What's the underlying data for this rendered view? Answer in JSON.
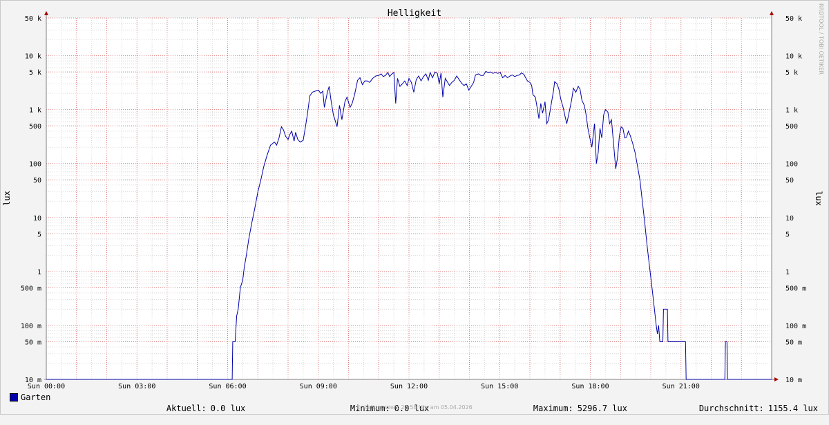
{
  "watermark": "RRDTOOL / TOBI OETIKER",
  "footer_text": "Erstellungszeit: 23:58 Uhr am 05.04.2026",
  "colors": {
    "series": "#0000aa",
    "background": "#f3f3f3",
    "plot_area": "#ffffff",
    "major_grid": "#e08080",
    "minor_grid": "#d8d8d8",
    "axis": "#808080",
    "arrow": "#aa0000"
  },
  "legend": {
    "series_name": "Garten",
    "aktuell_label": "Aktuell:",
    "aktuell_value": "0.0 lux",
    "minimum_label": "Minimum:",
    "minimum_value": "0.0 lux",
    "maximum_label": "Maximum:",
    "maximum_value": "5296.7 lux",
    "durchschnitt_label": "Durchschnitt:",
    "durchschnitt_value": "1155.4 lux"
  },
  "chart_data": {
    "type": "line",
    "title": "Helligkeit",
    "ylabel": "lux",
    "ylabel_right": "lux",
    "yscale": "log",
    "ylim": [
      10,
      50000
    ],
    "yunit_min": 0.01,
    "xlim": [
      0,
      24
    ],
    "grid": true,
    "xticks": [
      {
        "value": 0,
        "label": "Sun 00:00"
      },
      {
        "value": 3,
        "label": "Sun 03:00"
      },
      {
        "value": 6,
        "label": "Sun 06:00"
      },
      {
        "value": 9,
        "label": "Sun 09:00"
      },
      {
        "value": 12,
        "label": "Sun 12:00"
      },
      {
        "value": 15,
        "label": "Sun 15:00"
      },
      {
        "value": 18,
        "label": "Sun 18:00"
      },
      {
        "value": 21,
        "label": "Sun 21:00"
      }
    ],
    "yticks": [
      {
        "value": 50000,
        "label": "50 k"
      },
      {
        "value": 10000,
        "label": "10 k"
      },
      {
        "value": 5000,
        "label": "5 k"
      },
      {
        "value": 1000,
        "label": "1 k"
      },
      {
        "value": 500,
        "label": "500"
      },
      {
        "value": 100,
        "label": "100"
      },
      {
        "value": 50,
        "label": "50"
      },
      {
        "value": 10,
        "label": "10"
      },
      {
        "value": 5,
        "label": "5"
      },
      {
        "value": 1,
        "label": "1"
      },
      {
        "value": 0.5,
        "label": "500 m"
      },
      {
        "value": 0.1,
        "label": "100 m"
      },
      {
        "value": 0.05,
        "label": "50 m"
      },
      {
        "value": 0.01,
        "label": "10 m"
      }
    ],
    "series": [
      {
        "name": "Garten",
        "points": [
          [
            0.0,
            0.01
          ],
          [
            6.15,
            0.01
          ],
          [
            6.17,
            0.05
          ],
          [
            6.25,
            0.05
          ],
          [
            6.3,
            0.15
          ],
          [
            6.35,
            0.2
          ],
          [
            6.42,
            0.5
          ],
          [
            6.5,
            0.7
          ],
          [
            6.55,
            1.2
          ],
          [
            6.62,
            2
          ],
          [
            6.7,
            4
          ],
          [
            6.8,
            8
          ],
          [
            6.9,
            15
          ],
          [
            7.0,
            30
          ],
          [
            7.1,
            50
          ],
          [
            7.2,
            90
          ],
          [
            7.3,
            140
          ],
          [
            7.42,
            220
          ],
          [
            7.55,
            250
          ],
          [
            7.62,
            220
          ],
          [
            7.7,
            300
          ],
          [
            7.78,
            480
          ],
          [
            7.85,
            420
          ],
          [
            7.92,
            320
          ],
          [
            8.0,
            280
          ],
          [
            8.05,
            340
          ],
          [
            8.12,
            400
          ],
          [
            8.2,
            260
          ],
          [
            8.25,
            380
          ],
          [
            8.32,
            280
          ],
          [
            8.4,
            250
          ],
          [
            8.5,
            270
          ],
          [
            8.58,
            500
          ],
          [
            8.65,
            900
          ],
          [
            8.72,
            1800
          ],
          [
            8.8,
            2100
          ],
          [
            8.9,
            2200
          ],
          [
            9.0,
            2300
          ],
          [
            9.08,
            2000
          ],
          [
            9.15,
            2200
          ],
          [
            9.2,
            1100
          ],
          [
            9.3,
            2100
          ],
          [
            9.36,
            2700
          ],
          [
            9.42,
            1500
          ],
          [
            9.5,
            800
          ],
          [
            9.56,
            620
          ],
          [
            9.62,
            480
          ],
          [
            9.7,
            1200
          ],
          [
            9.78,
            650
          ],
          [
            9.88,
            1400
          ],
          [
            9.95,
            1700
          ],
          [
            10.05,
            1100
          ],
          [
            10.12,
            1300
          ],
          [
            10.2,
            1900
          ],
          [
            10.3,
            3500
          ],
          [
            10.38,
            3900
          ],
          [
            10.46,
            2900
          ],
          [
            10.54,
            3400
          ],
          [
            10.62,
            3400
          ],
          [
            10.7,
            3200
          ],
          [
            10.8,
            3800
          ],
          [
            10.9,
            4200
          ],
          [
            11.0,
            4300
          ],
          [
            11.08,
            4600
          ],
          [
            11.15,
            4100
          ],
          [
            11.22,
            4300
          ],
          [
            11.3,
            4900
          ],
          [
            11.36,
            4100
          ],
          [
            11.42,
            4500
          ],
          [
            11.5,
            4900
          ],
          [
            11.56,
            1300
          ],
          [
            11.62,
            3800
          ],
          [
            11.7,
            2700
          ],
          [
            11.78,
            3000
          ],
          [
            11.86,
            3400
          ],
          [
            11.94,
            2800
          ],
          [
            12.0,
            3800
          ],
          [
            12.08,
            3200
          ],
          [
            12.16,
            2100
          ],
          [
            12.24,
            3600
          ],
          [
            12.32,
            4200
          ],
          [
            12.4,
            3400
          ],
          [
            12.48,
            4100
          ],
          [
            12.56,
            4600
          ],
          [
            12.64,
            3500
          ],
          [
            12.7,
            4900
          ],
          [
            12.78,
            3900
          ],
          [
            12.86,
            5000
          ],
          [
            12.94,
            4700
          ],
          [
            13.0,
            3000
          ],
          [
            13.06,
            4800
          ],
          [
            13.12,
            1700
          ],
          [
            13.2,
            3800
          ],
          [
            13.28,
            3200
          ],
          [
            13.34,
            2800
          ],
          [
            13.42,
            3200
          ],
          [
            13.5,
            3500
          ],
          [
            13.58,
            4200
          ],
          [
            13.66,
            3600
          ],
          [
            13.74,
            3100
          ],
          [
            13.82,
            2800
          ],
          [
            13.9,
            3000
          ],
          [
            13.98,
            2300
          ],
          [
            14.06,
            2700
          ],
          [
            14.14,
            3200
          ],
          [
            14.2,
            4400
          ],
          [
            14.3,
            4600
          ],
          [
            14.38,
            4300
          ],
          [
            14.46,
            4300
          ],
          [
            14.54,
            5100
          ],
          [
            14.62,
            4900
          ],
          [
            14.7,
            5000
          ],
          [
            14.78,
            4700
          ],
          [
            14.86,
            4900
          ],
          [
            14.94,
            4700
          ],
          [
            15.02,
            4900
          ],
          [
            15.1,
            3900
          ],
          [
            15.18,
            4300
          ],
          [
            15.26,
            3900
          ],
          [
            15.34,
            4200
          ],
          [
            15.42,
            4400
          ],
          [
            15.5,
            4100
          ],
          [
            15.58,
            4300
          ],
          [
            15.66,
            4400
          ],
          [
            15.72,
            4800
          ],
          [
            15.8,
            4500
          ],
          [
            15.86,
            3900
          ],
          [
            15.92,
            3400
          ],
          [
            16.0,
            3200
          ],
          [
            16.06,
            2800
          ],
          [
            16.1,
            1900
          ],
          [
            16.18,
            1700
          ],
          [
            16.24,
            1100
          ],
          [
            16.3,
            680
          ],
          [
            16.36,
            1300
          ],
          [
            16.42,
            860
          ],
          [
            16.5,
            1400
          ],
          [
            16.56,
            550
          ],
          [
            16.62,
            650
          ],
          [
            16.7,
            1200
          ],
          [
            16.78,
            2200
          ],
          [
            16.82,
            3300
          ],
          [
            16.9,
            3000
          ],
          [
            16.96,
            2400
          ],
          [
            17.02,
            1600
          ],
          [
            17.1,
            1100
          ],
          [
            17.16,
            760
          ],
          [
            17.22,
            550
          ],
          [
            17.3,
            900
          ],
          [
            17.38,
            1500
          ],
          [
            17.44,
            2500
          ],
          [
            17.52,
            2100
          ],
          [
            17.6,
            2700
          ],
          [
            17.66,
            2400
          ],
          [
            17.72,
            1500
          ],
          [
            17.8,
            1200
          ],
          [
            17.86,
            800
          ],
          [
            17.92,
            450
          ],
          [
            17.98,
            310
          ],
          [
            18.05,
            200
          ],
          [
            18.1,
            350
          ],
          [
            18.14,
            550
          ],
          [
            18.2,
            100
          ],
          [
            18.26,
            160
          ],
          [
            18.32,
            450
          ],
          [
            18.38,
            300
          ],
          [
            18.44,
            800
          ],
          [
            18.5,
            1000
          ],
          [
            18.58,
            900
          ],
          [
            18.64,
            550
          ],
          [
            18.7,
            650
          ],
          [
            18.78,
            200
          ],
          [
            18.84,
            80
          ],
          [
            18.9,
            130
          ],
          [
            18.96,
            320
          ],
          [
            19.02,
            480
          ],
          [
            19.08,
            450
          ],
          [
            19.14,
            300
          ],
          [
            19.2,
            310
          ],
          [
            19.26,
            400
          ],
          [
            19.32,
            330
          ],
          [
            19.4,
            240
          ],
          [
            19.48,
            160
          ],
          [
            19.56,
            90
          ],
          [
            19.64,
            50
          ],
          [
            19.72,
            20
          ],
          [
            19.8,
            8
          ],
          [
            19.88,
            3
          ],
          [
            19.96,
            1.2
          ],
          [
            20.04,
            0.5
          ],
          [
            20.12,
            0.2
          ],
          [
            20.18,
            0.1
          ],
          [
            20.22,
            0.07
          ],
          [
            20.26,
            0.1
          ],
          [
            20.3,
            0.05
          ],
          [
            20.4,
            0.05
          ],
          [
            20.42,
            0.2
          ],
          [
            20.55,
            0.2
          ],
          [
            20.57,
            0.05
          ],
          [
            21.15,
            0.05
          ],
          [
            21.17,
            0.01
          ],
          [
            22.45,
            0.01
          ],
          [
            22.47,
            0.05
          ],
          [
            22.52,
            0.05
          ],
          [
            22.54,
            0.01
          ],
          [
            24.0,
            0.01
          ]
        ]
      }
    ]
  }
}
